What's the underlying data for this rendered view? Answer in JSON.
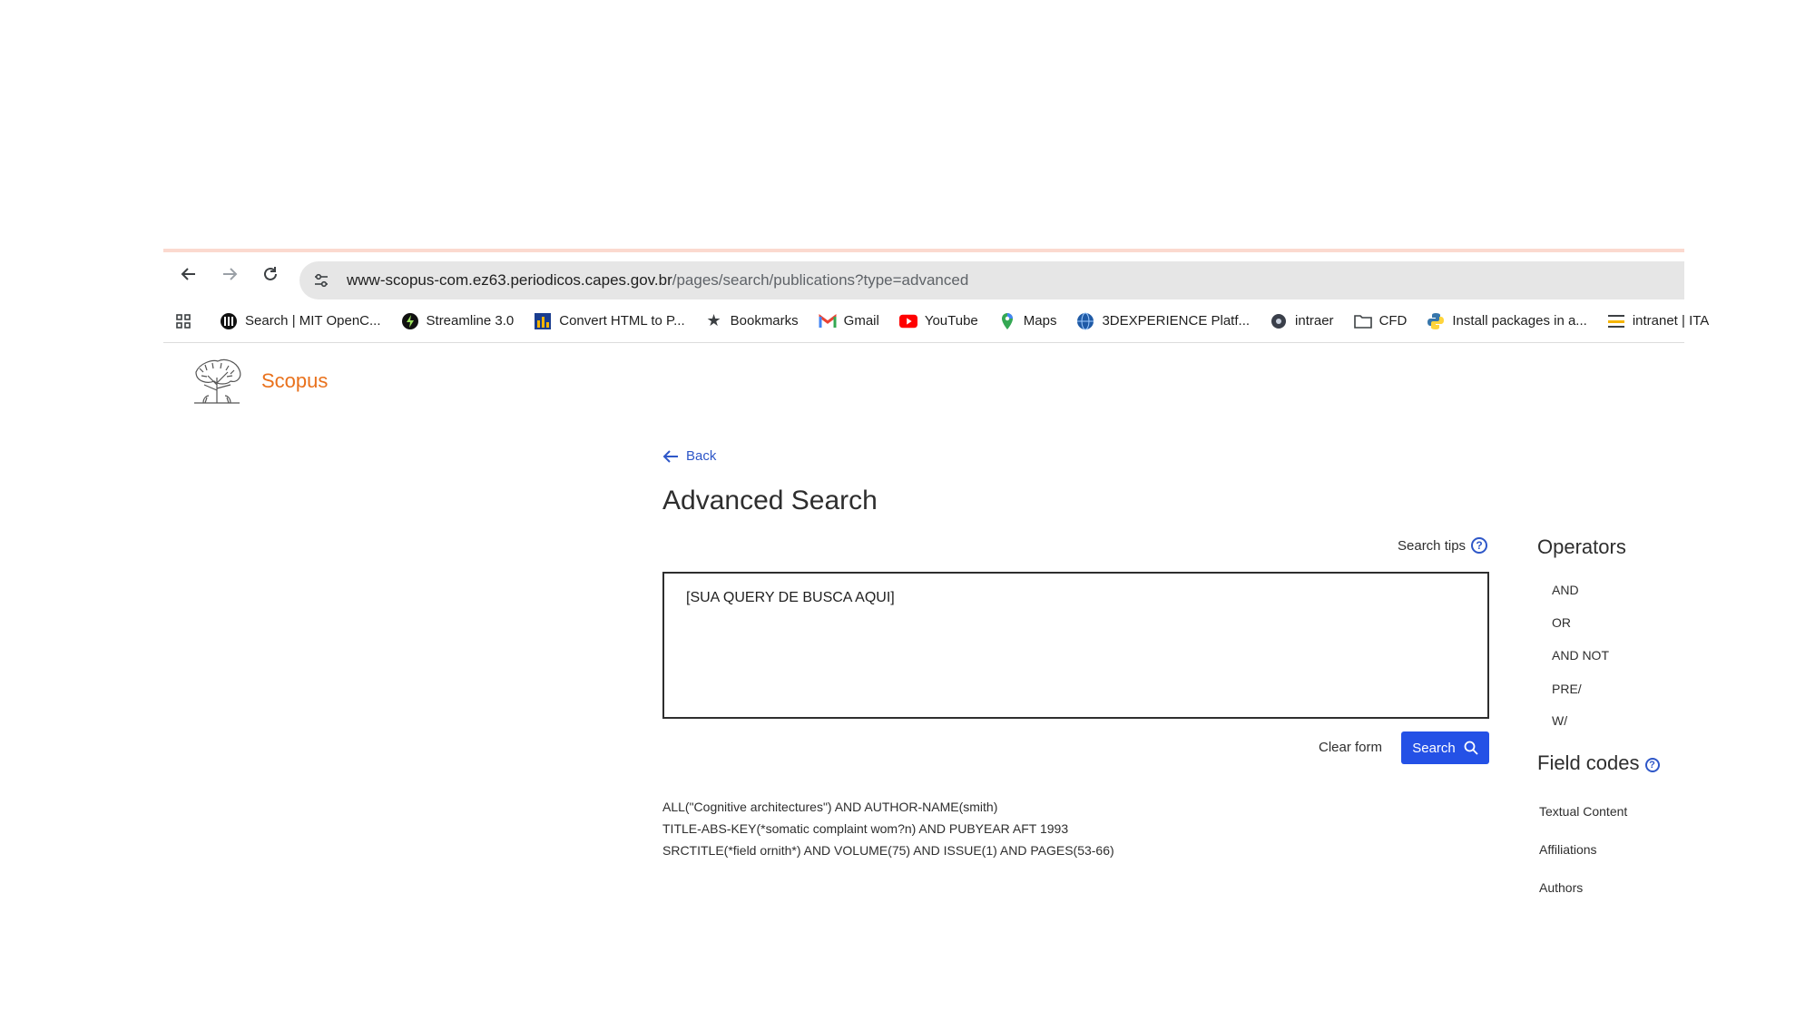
{
  "browser": {
    "url_domain": "www-scopus-com.ez63.periodicos.capes.gov.br",
    "url_path": "/pages/search/publications?type=advanced",
    "bookmarks": [
      {
        "label": "Search | MIT OpenC...",
        "icon": "mit-icon"
      },
      {
        "label": "Streamline 3.0",
        "icon": "streamline-icon"
      },
      {
        "label": "Convert HTML to P...",
        "icon": "chart-icon"
      },
      {
        "label": "Bookmarks",
        "icon": "star-icon"
      },
      {
        "label": "Gmail",
        "icon": "gmail-icon"
      },
      {
        "label": "YouTube",
        "icon": "youtube-icon"
      },
      {
        "label": "Maps",
        "icon": "maps-icon"
      },
      {
        "label": "3DEXPERIENCE Platf...",
        "icon": "globe-icon"
      },
      {
        "label": "intraer",
        "icon": "intraer-icon"
      },
      {
        "label": "CFD",
        "icon": "folder-icon"
      },
      {
        "label": "Install packages in a...",
        "icon": "python-icon"
      },
      {
        "label": "intranet | ITA",
        "icon": "ita-icon"
      }
    ]
  },
  "header": {
    "brand": "Scopus"
  },
  "main": {
    "back": "Back",
    "title": "Advanced Search",
    "search_tips": "Search tips",
    "query": "[SUA QUERY DE BUSCA AQUI]",
    "clear_form": "Clear form",
    "search": "Search",
    "examples": [
      "ALL(\"Cognitive architectures\") AND AUTHOR-NAME(smith)",
      "TITLE-ABS-KEY(*somatic complaint wom?n) AND PUBYEAR AFT 1993",
      "SRCTITLE(*field ornith*) AND VOLUME(75) AND ISSUE(1) AND PAGES(53-66)"
    ]
  },
  "sidebar": {
    "operators_title": "Operators",
    "operators": [
      "AND",
      "OR",
      "AND NOT",
      "PRE/",
      "W/"
    ],
    "field_codes_title": "Field codes",
    "field_codes": [
      "Textual Content",
      "Affiliations",
      "Authors"
    ]
  },
  "colors": {
    "brand": "#e9711c",
    "link": "#2e57c8",
    "primary_button": "#2451e6"
  }
}
